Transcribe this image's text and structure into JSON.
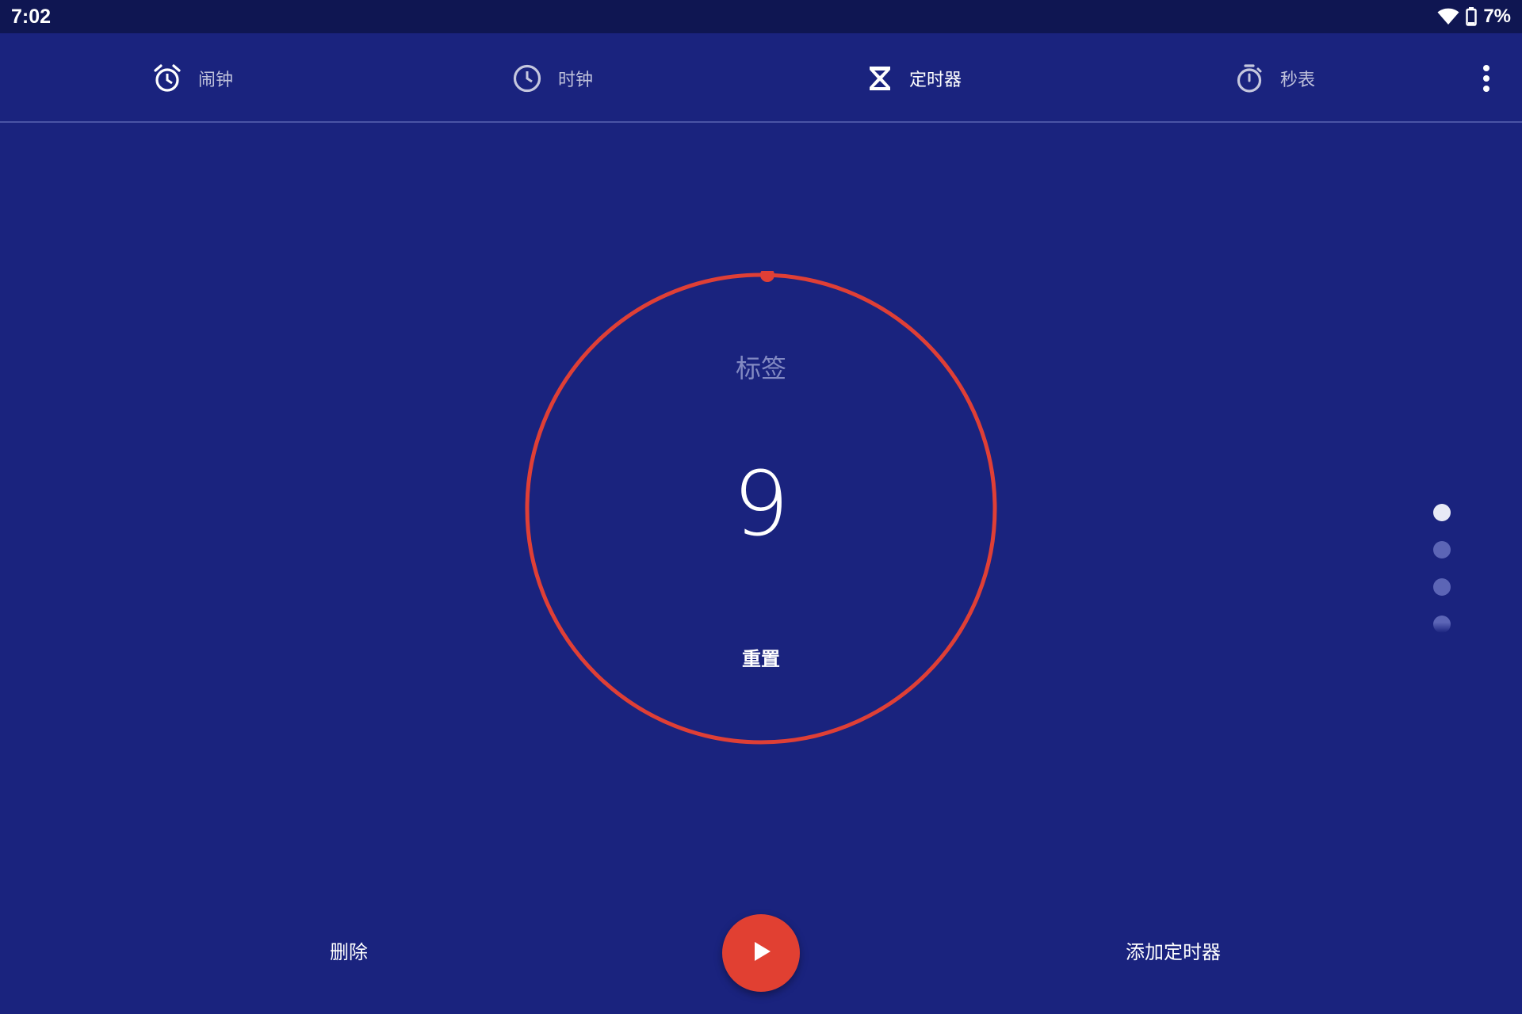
{
  "status_bar": {
    "time": "7:02",
    "battery": "7%",
    "icons": [
      "wifi-icon",
      "battery-icon"
    ]
  },
  "tabs": [
    {
      "label": "闹钟",
      "icon": "alarm-clock-icon",
      "active": false
    },
    {
      "label": "时钟",
      "icon": "clock-icon",
      "active": false
    },
    {
      "label": "定时器",
      "icon": "hourglass-icon",
      "active": true
    },
    {
      "label": "秒表",
      "icon": "stopwatch-icon",
      "active": false
    }
  ],
  "overflow_icon": "more-vertical-icon",
  "timer": {
    "label": "标签",
    "value": "9",
    "reset_label": "重置",
    "progress": 1.0
  },
  "page_indicator": {
    "count": 4,
    "active_index": 0
  },
  "actions": {
    "delete_label": "删除",
    "add_timer_label": "添加定时器",
    "play_icon": "play-icon"
  },
  "colors": {
    "background": "#1a237e",
    "status_bar": "#0f1652",
    "accent": "#e14032",
    "ring": "#df3f36"
  }
}
